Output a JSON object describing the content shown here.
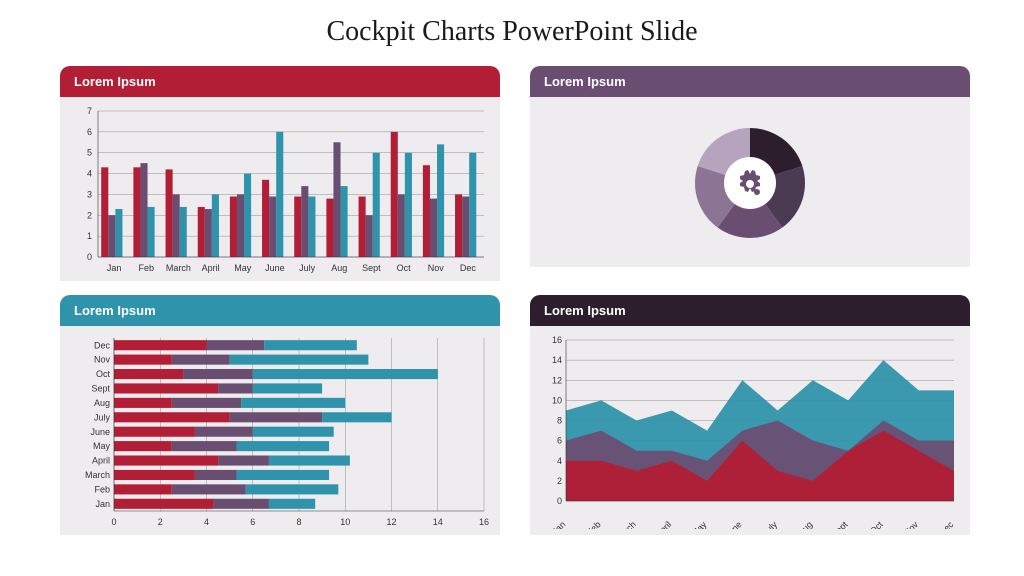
{
  "title": "Cockpit Charts PowerPoint Slide",
  "panels": {
    "topLeft": {
      "label": "Lorem Ipsum"
    },
    "topRight": {
      "label": "Lorem Ipsum"
    },
    "botLeft": {
      "label": "Lorem Ipsum"
    },
    "botRight": {
      "label": "Lorem Ipsum"
    }
  },
  "colors": {
    "red": "#b21e35",
    "teal": "#2f93ab",
    "purple": "#6a4e72",
    "dark": "#2c1e2d"
  },
  "chart_data": [
    {
      "id": "topLeft",
      "type": "bar",
      "categories": [
        "Jan",
        "Feb",
        "March",
        "April",
        "May",
        "June",
        "July",
        "Aug",
        "Sept",
        "Oct",
        "Nov",
        "Dec"
      ],
      "series": [
        {
          "name": "red",
          "values": [
            4.3,
            4.3,
            4.2,
            2.4,
            2.9,
            3.7,
            2.9,
            2.8,
            2.9,
            6.0,
            4.4,
            3.0
          ]
        },
        {
          "name": "purple",
          "values": [
            2.0,
            4.5,
            3.0,
            2.3,
            3.0,
            2.9,
            3.4,
            5.5,
            2.0,
            3.0,
            2.8,
            2.9
          ]
        },
        {
          "name": "teal",
          "values": [
            2.3,
            2.4,
            2.4,
            3.0,
            4.0,
            6.0,
            2.9,
            3.4,
            5.0,
            5.0,
            5.4,
            5.0
          ]
        }
      ],
      "y_ticks": [
        0,
        1,
        2,
        3,
        4,
        5,
        6,
        7
      ],
      "ylim": [
        0,
        7
      ]
    },
    {
      "id": "topRight",
      "type": "pie",
      "slices": [
        {
          "color": "#2c1e2d",
          "value": 20
        },
        {
          "color": "#4a3a52",
          "value": 20
        },
        {
          "color": "#6a4e72",
          "value": 20
        },
        {
          "color": "#8c7494",
          "value": 20
        },
        {
          "color": "#b6a3bd",
          "value": 20
        }
      ],
      "center_icon": "gear-icon"
    },
    {
      "id": "botLeft",
      "type": "bar",
      "orientation": "horizontal",
      "stacked": true,
      "categories": [
        "Jan",
        "Feb",
        "March",
        "April",
        "May",
        "June",
        "July",
        "Aug",
        "Sept",
        "Oct",
        "Nov",
        "Dec"
      ],
      "series": [
        {
          "name": "red",
          "values": [
            4.3,
            2.5,
            3.5,
            4.5,
            2.5,
            3.5,
            5.0,
            2.5,
            4.5,
            3.0,
            2.5,
            4.0
          ]
        },
        {
          "name": "purple",
          "values": [
            2.4,
            3.2,
            1.8,
            2.2,
            2.8,
            2.5,
            4.0,
            3.0,
            1.5,
            3.0,
            2.5,
            2.5
          ]
        },
        {
          "name": "teal",
          "values": [
            2.0,
            4.0,
            4.0,
            3.5,
            4.0,
            3.5,
            3.0,
            4.5,
            3.0,
            8.0,
            6.0,
            4.0
          ]
        }
      ],
      "x_ticks": [
        0,
        2,
        4,
        6,
        8,
        10,
        12,
        14,
        16
      ],
      "xlim": [
        0,
        16
      ]
    },
    {
      "id": "botRight",
      "type": "area",
      "stacked": false,
      "categories": [
        "Jan",
        "Feb",
        "March",
        "April",
        "May",
        "June",
        "July",
        "Aug",
        "Sept",
        "Oct",
        "Nov",
        "Dec"
      ],
      "series": [
        {
          "name": "teal",
          "values": [
            9,
            10,
            8,
            9,
            7,
            12,
            9,
            12,
            10,
            14,
            11,
            11
          ]
        },
        {
          "name": "purple",
          "values": [
            6,
            7,
            5,
            5,
            4,
            7,
            8,
            6,
            5,
            8,
            6,
            6
          ]
        },
        {
          "name": "red",
          "values": [
            4,
            4,
            3,
            4,
            2,
            6,
            3,
            2,
            5,
            7,
            5,
            3
          ]
        }
      ],
      "y_ticks": [
        0,
        2,
        4,
        6,
        8,
        10,
        12,
        14,
        16
      ],
      "ylim": [
        0,
        16
      ]
    }
  ]
}
